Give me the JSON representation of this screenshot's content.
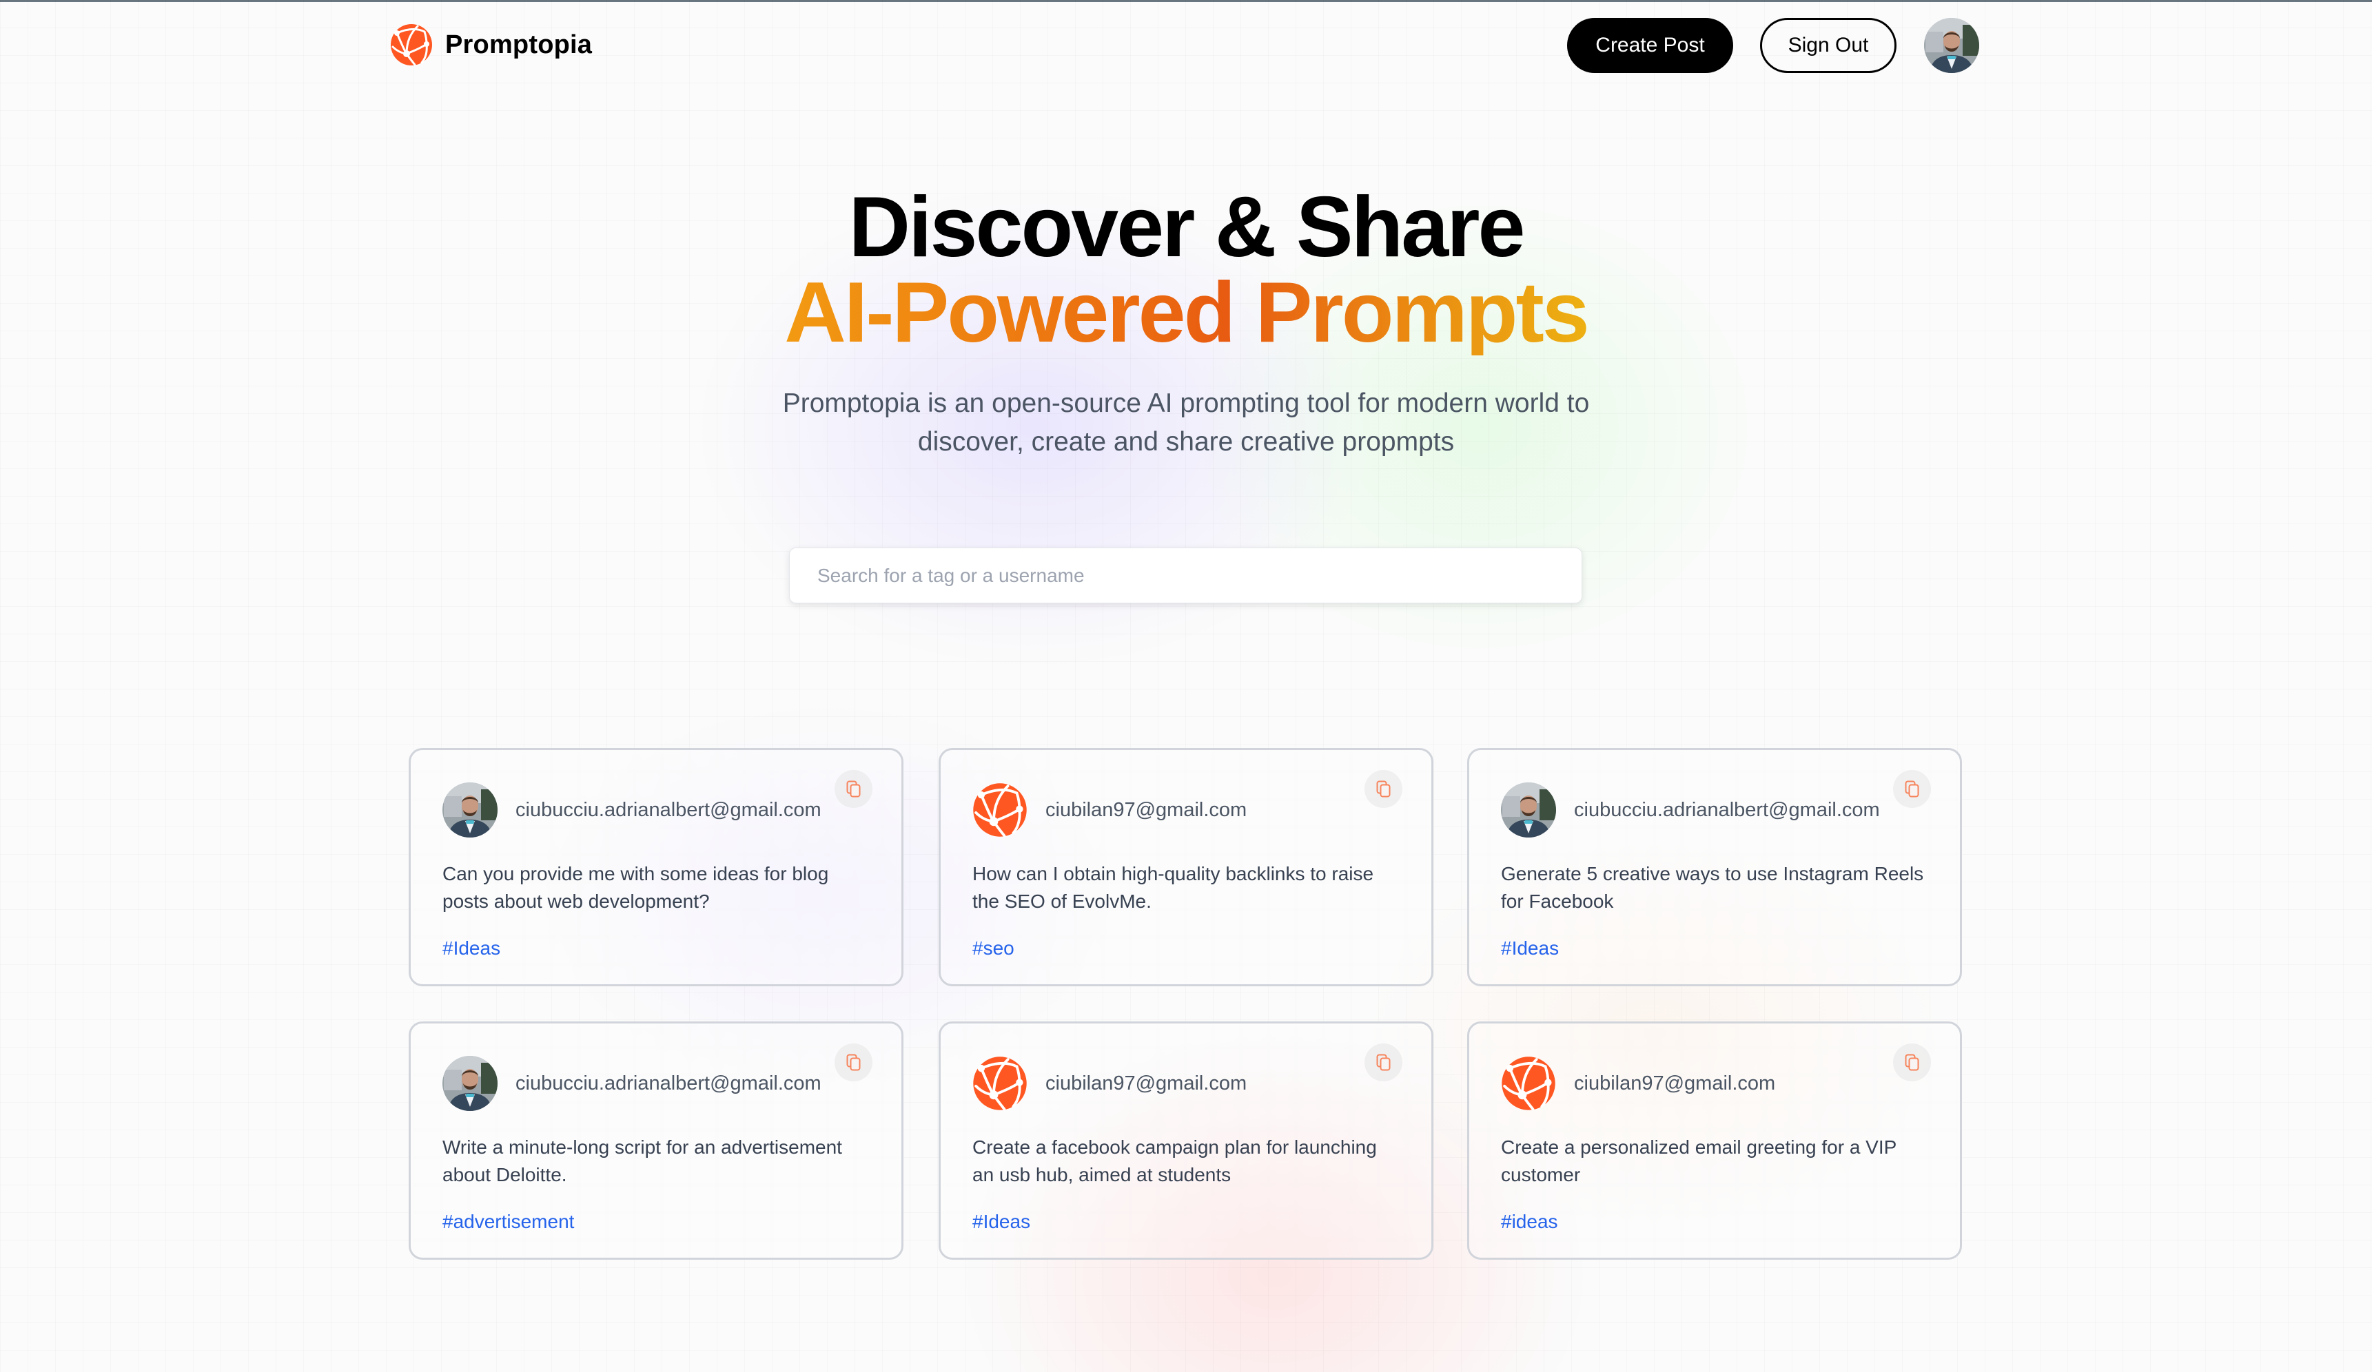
{
  "nav": {
    "logo_icon": "globe-network-icon",
    "logo_text": "Promptopia",
    "create_post_label": "Create Post",
    "sign_out_label": "Sign Out",
    "profile_avatar": "user-photo-avatar"
  },
  "hero": {
    "title_line1": "Discover & Share",
    "title_line2": "AI-Powered Prompts",
    "description": "Promptopia is an open-source AI prompting tool for modern world to discover, create and share creative propmpts"
  },
  "search": {
    "placeholder": "Search for a tag or a username",
    "value": ""
  },
  "colors": {
    "brand_orange": "#ff5722",
    "tag_blue": "#2563eb",
    "gradient_start": "#f29a12",
    "gradient_mid": "#e85b12",
    "gradient_end": "#edb012"
  },
  "prompts": [
    {
      "avatar": "user-photo-avatar",
      "email": "ciubucciu.adrianalbert@gmail.com",
      "prompt": "Can you provide me with some ideas for blog posts about web development?",
      "tag": "#Ideas",
      "copy_icon": "copy-icon"
    },
    {
      "avatar": "globe-network-icon",
      "email": "ciubilan97@gmail.com",
      "prompt": "How can I obtain high-quality backlinks to raise the SEO of EvolvMe.",
      "tag": "#seo",
      "copy_icon": "copy-icon"
    },
    {
      "avatar": "user-photo-avatar",
      "email": "ciubucciu.adrianalbert@gmail.com",
      "prompt": "Generate 5 creative ways to use Instagram Reels for Facebook",
      "tag": "#Ideas",
      "copy_icon": "copy-icon"
    },
    {
      "avatar": "user-photo-avatar",
      "email": "ciubucciu.adrianalbert@gmail.com",
      "prompt": "Write a minute-long script for an advertisement about Deloitte.",
      "tag": "#advertisement",
      "copy_icon": "copy-icon"
    },
    {
      "avatar": "globe-network-icon",
      "email": "ciubilan97@gmail.com",
      "prompt": "Create a facebook campaign plan for launching an usb hub, aimed at students",
      "tag": "#Ideas",
      "copy_icon": "copy-icon"
    },
    {
      "avatar": "globe-network-icon",
      "email": "ciubilan97@gmail.com",
      "prompt": "Create a personalized email greeting for a VIP customer",
      "tag": "#ideas",
      "copy_icon": "copy-icon"
    }
  ]
}
